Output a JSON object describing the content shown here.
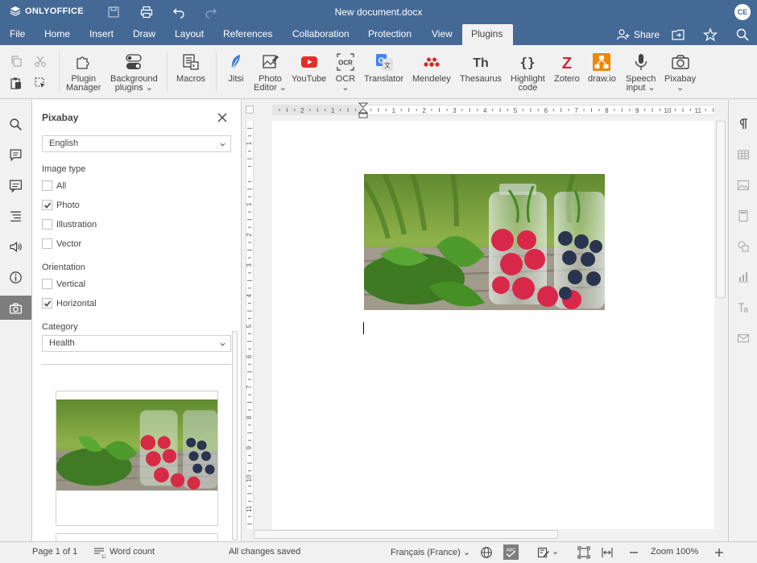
{
  "app": {
    "brand": "ONLYOFFICE",
    "document_title": "New document.docx",
    "user_initials": "CE",
    "accent": "#446995"
  },
  "tabs": [
    "File",
    "Home",
    "Insert",
    "Draw",
    "Layout",
    "References",
    "Collaboration",
    "Protection",
    "View",
    "Plugins"
  ],
  "active_tab": "Plugins",
  "header_right": {
    "share": "Share"
  },
  "toolbar": {
    "plugin_manager": [
      "Plugin",
      "Manager"
    ],
    "background_plugins": [
      "Background",
      "plugins"
    ],
    "macros": "Macros",
    "jitsi": "Jitsi",
    "photo_editor": [
      "Photo",
      "Editor"
    ],
    "youtube": "YouTube",
    "ocr": "OCR",
    "translator": "Translator",
    "mendeley": "Mendeley",
    "thesaurus": "Thesaurus",
    "highlight_code": [
      "Highlight",
      "code"
    ],
    "zotero": "Zotero",
    "drawio": "draw.io",
    "speech_input": [
      "Speech",
      "input"
    ],
    "pixabay": "Pixabay"
  },
  "panel": {
    "title": "Pixabay",
    "language": "English",
    "image_type_label": "Image type",
    "image_types": [
      {
        "label": "All",
        "checked": false
      },
      {
        "label": "Photo",
        "checked": true
      },
      {
        "label": "Illustration",
        "checked": false
      },
      {
        "label": "Vector",
        "checked": false
      }
    ],
    "orientation_label": "Orientation",
    "orientations": [
      {
        "label": "Vertical",
        "checked": false
      },
      {
        "label": "Horizontal",
        "checked": true
      }
    ],
    "category_label": "Category",
    "category": "Health"
  },
  "ruler": {
    "h_ticks": [
      "2",
      "1",
      "1",
      "2",
      "3",
      "4",
      "5",
      "6",
      "7",
      "8",
      "9",
      "10",
      "11"
    ],
    "v_ticks": [
      "1",
      "1",
      "2",
      "3",
      "4",
      "5",
      "6",
      "7",
      "8",
      "9",
      "10",
      "11"
    ]
  },
  "status": {
    "page": "Page 1 of 1",
    "word_count": "Word count",
    "saved": "All changes saved",
    "language": "Français (France)",
    "zoom": "Zoom 100%"
  }
}
